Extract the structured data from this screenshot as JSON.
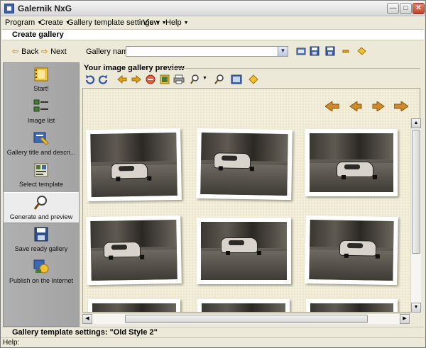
{
  "window": {
    "title": "Galernik NxG"
  },
  "menu": [
    {
      "label": "Program"
    },
    {
      "label": "Create"
    },
    {
      "label": "Gallery template settings"
    },
    {
      "label": "View"
    },
    {
      "label": "Help"
    }
  ],
  "section": {
    "title": "Create gallery"
  },
  "toolbar": {
    "back_label": "Back",
    "next_label": "Next",
    "gallery_name_label": "Gallery name:",
    "gallery_name_value": ""
  },
  "sidebar": {
    "items": [
      {
        "label": "Start!",
        "icon": "film-icon"
      },
      {
        "label": "Image list",
        "icon": "list-icon"
      },
      {
        "label": "Gallery title and descri...",
        "icon": "title-icon"
      },
      {
        "label": "Select template",
        "icon": "template-icon"
      },
      {
        "label": "Generate and preview",
        "icon": "magnifier-icon"
      },
      {
        "label": "Save ready gallery",
        "icon": "floppy-icon"
      },
      {
        "label": "Publish on the Internet",
        "icon": "globe-icon"
      }
    ]
  },
  "preview": {
    "label": "Your image gallery preview"
  },
  "status": {
    "template_settings": "Gallery template settings: \"Old Style 2\""
  },
  "help": {
    "text": "Help:"
  },
  "colors": {
    "accent_orange": "#e2a11a",
    "sepia_background": "#f2eeda",
    "sidebar_gray": "#aaaaaa"
  }
}
